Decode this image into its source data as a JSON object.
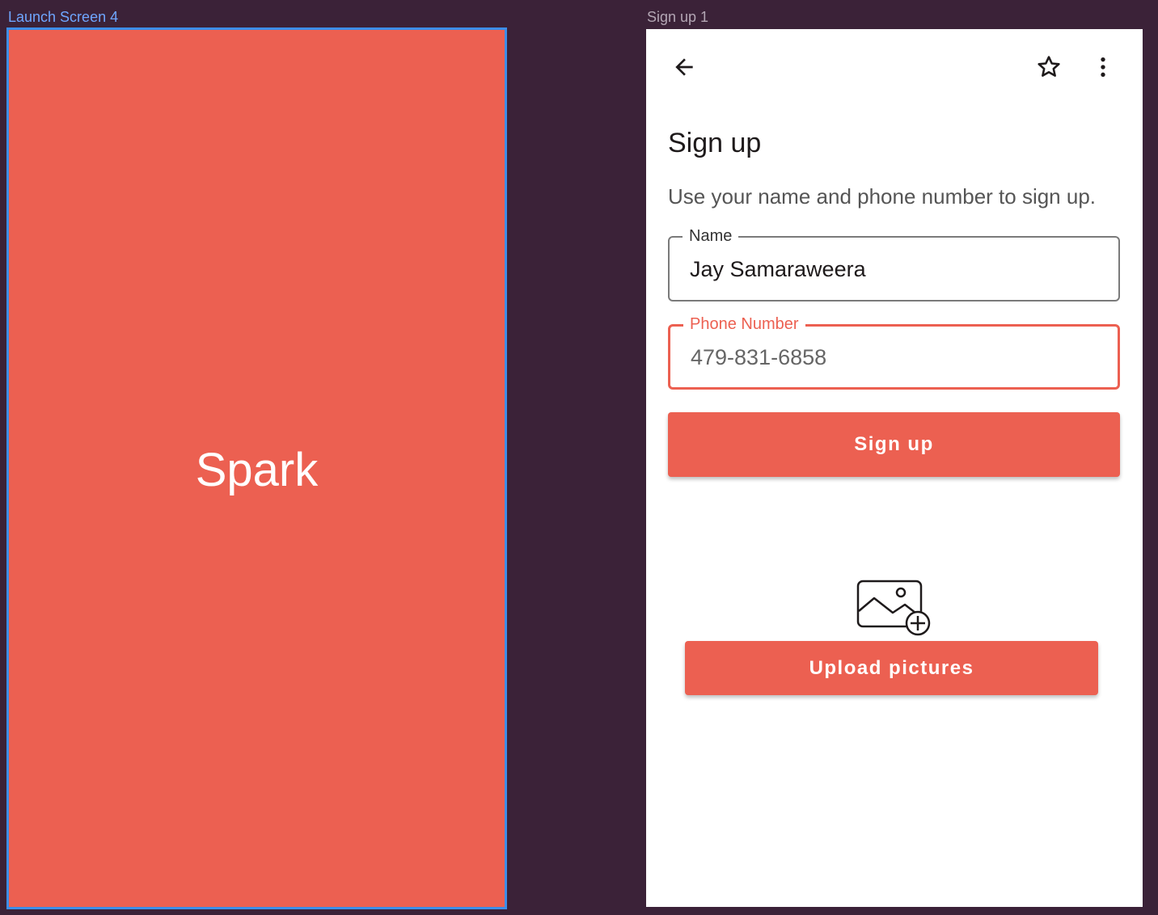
{
  "canvas": {
    "background": "#3b2238"
  },
  "frames": {
    "launch": {
      "label": "Launch Screen 4",
      "title": "Spark",
      "background": "#ec6051",
      "selected": true
    },
    "signup": {
      "label": "Sign up 1",
      "toolbar": {
        "back_icon": "arrow-left-icon",
        "favorite_icon": "star-outline-icon",
        "more_icon": "more-vertical-icon"
      },
      "title": "Sign up",
      "subtitle": "Use your name and phone number to sign up.",
      "fields": {
        "name": {
          "label": "Name",
          "value": "Jay Samaraweera"
        },
        "phone": {
          "label": "Phone Number",
          "value": "479-831-6858",
          "focused": true
        }
      },
      "signup_button_label": "Sign up",
      "upload": {
        "icon": "image-add-icon",
        "button_label": "Upload pictures"
      },
      "accent_color": "#ec6051"
    }
  }
}
